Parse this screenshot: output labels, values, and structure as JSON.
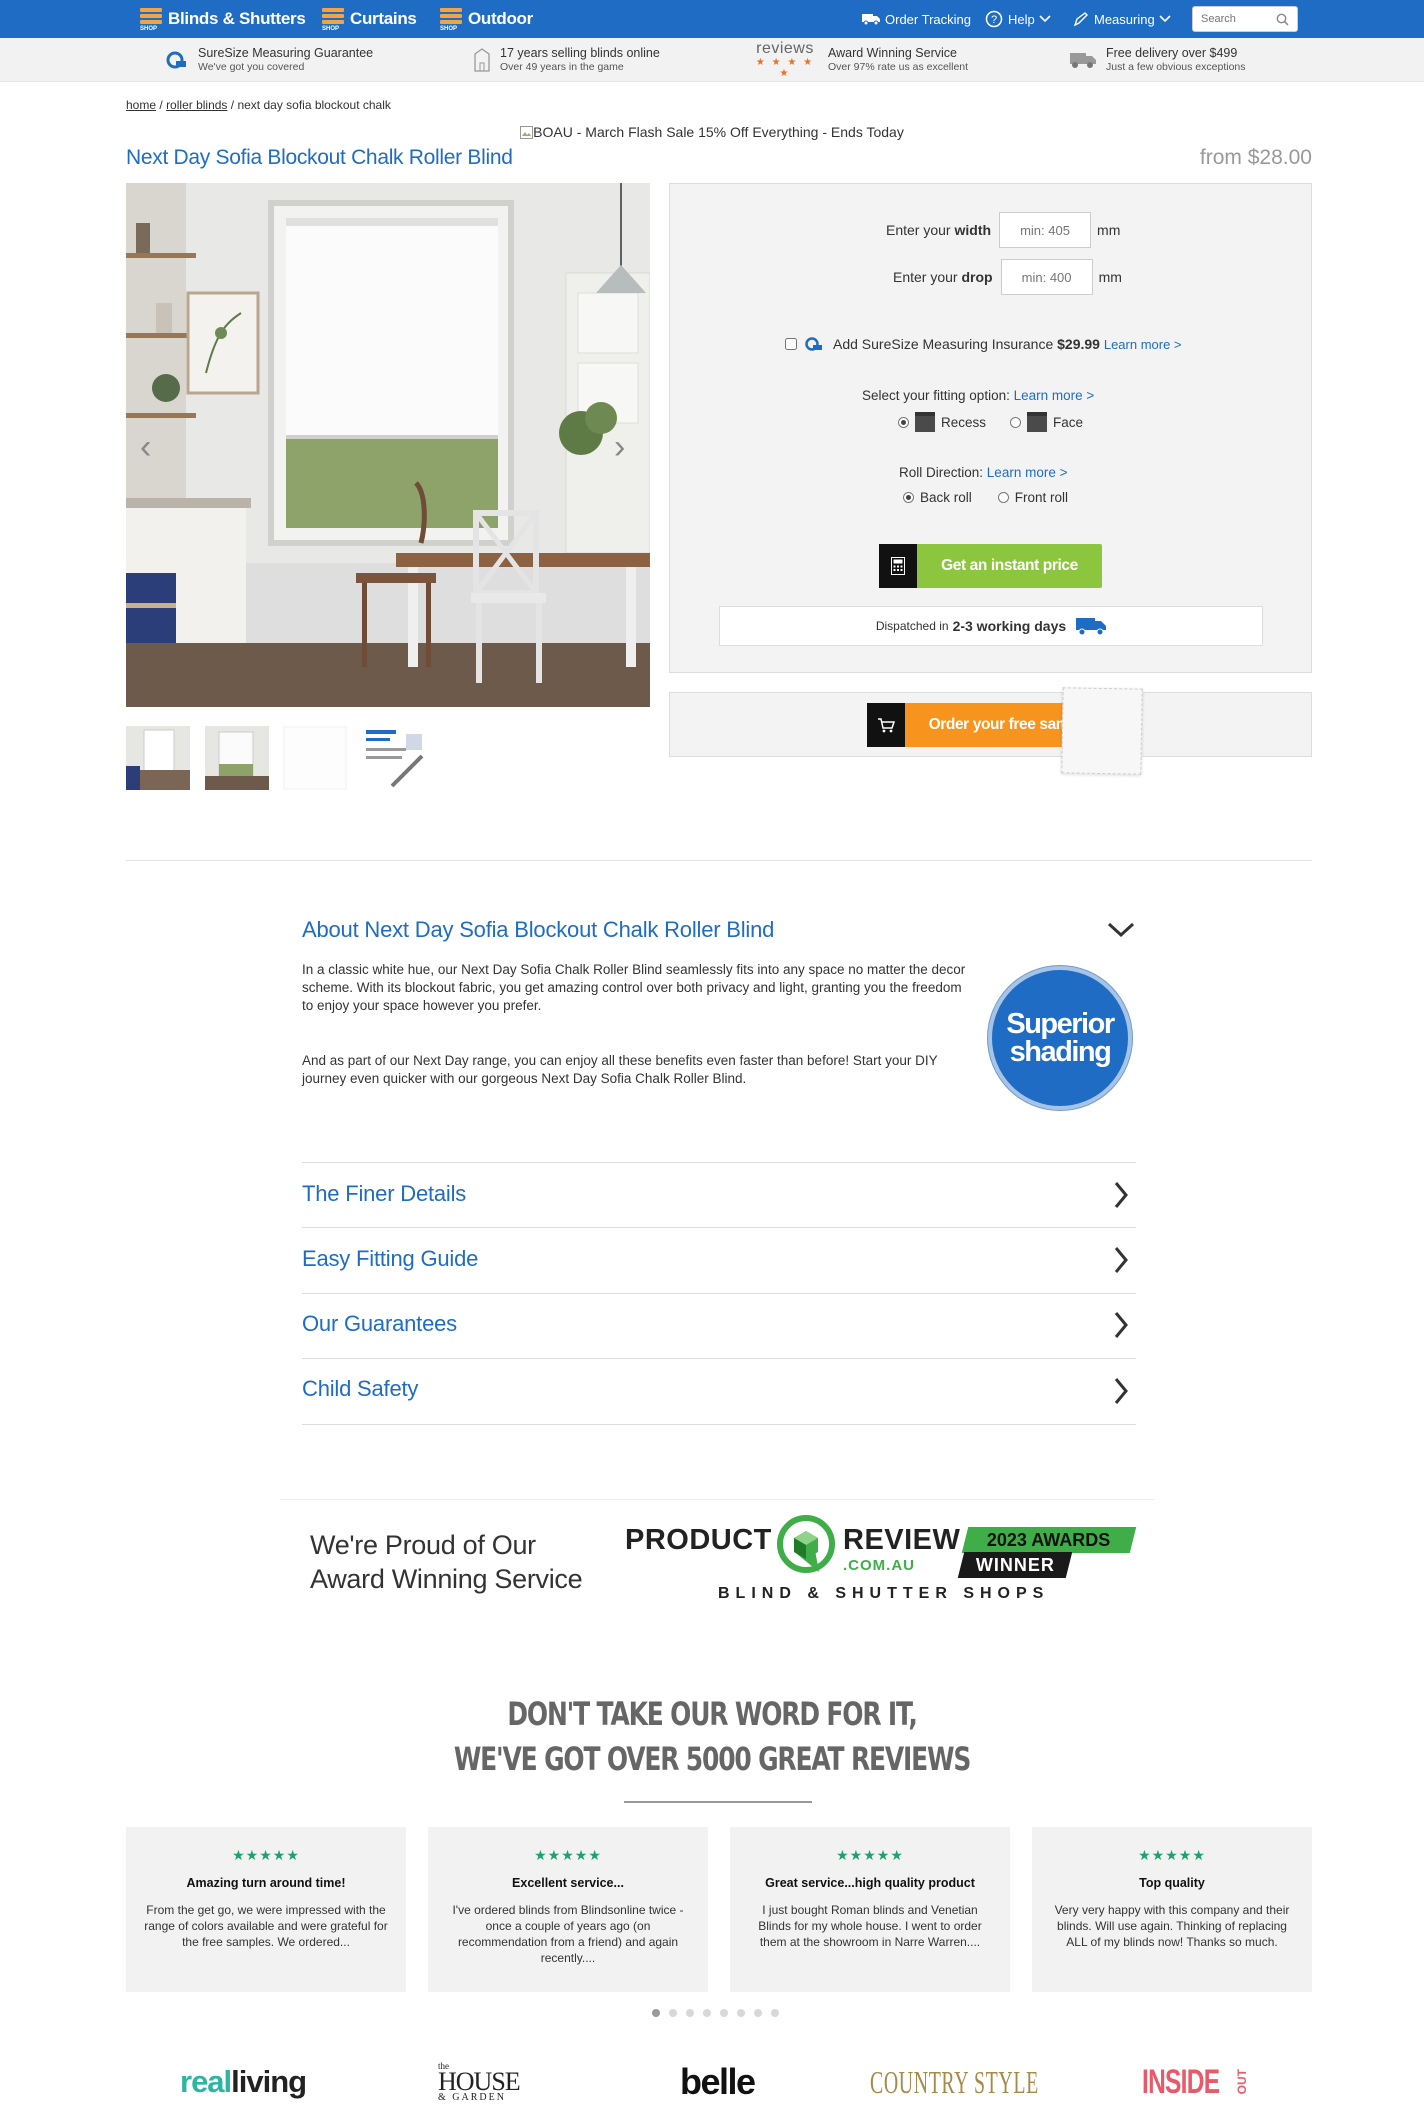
{
  "nav": {
    "items": [
      {
        "label": "Blinds & Shutters",
        "badge": "SHOP"
      },
      {
        "label": "Curtains",
        "badge": "SHOP"
      },
      {
        "label": "Outdoor",
        "badge": "SHOP"
      }
    ],
    "order_tracking": "Order Tracking",
    "help": "Help",
    "measuring": "Measuring",
    "search_placeholder": "Search"
  },
  "usp": [
    {
      "title": "SureSize Measuring Guarantee",
      "sub": "We've got you covered",
      "icon": "suresize-icon"
    },
    {
      "title": "17 years selling blinds online",
      "sub": "Over 49 years in the game",
      "icon": "building-icon"
    },
    {
      "title": "Award Winning Service",
      "sub": "Over 97% rate us as excellent",
      "icon": "reviews-logo",
      "logo_text": "reviews",
      "stars": "★ ★ ★ ★ ★"
    },
    {
      "title": "Free delivery over $499",
      "sub": "Just a few obvious exceptions",
      "icon": "truck-icon"
    }
  ],
  "breadcrumb": {
    "home": "home",
    "category": "roller blinds",
    "current": "next day sofia blockout chalk",
    "sep": "/"
  },
  "promo_banner": "BOAU - March Flash Sale 15% Off Everything - Ends Today",
  "product": {
    "title": "Next Day Sofia Blockout Chalk Roller Blind",
    "price": "from $28.00"
  },
  "configurator": {
    "width_label_pre": "Enter your",
    "width_label_bold": "width",
    "width_placeholder": "min: 405",
    "drop_label_pre": "Enter your",
    "drop_label_bold": "drop",
    "drop_placeholder": "min: 400",
    "unit": "mm",
    "insurance_label": "Add SureSize Measuring Insurance",
    "insurance_price": "$29.99",
    "learn_more": "Learn more >",
    "fitting_label": "Select your fitting option:",
    "fitting_options": [
      "Recess",
      "Face"
    ],
    "fitting_selected": "Recess",
    "roll_label": "Roll Direction:",
    "roll_options": [
      "Back roll",
      "Front roll"
    ],
    "roll_selected": "Back roll",
    "price_button": "Get an instant price",
    "dispatch_pre": "Dispatched in",
    "dispatch_days": "2-3 working days",
    "sample_button": "Order your free sample"
  },
  "about": {
    "title": "About Next Day Sofia Blockout Chalk Roller Blind",
    "p1": "In a classic white hue, our Next Day Sofia Chalk Roller Blind seamlessly fits into any space no matter the decor scheme. With its blockout fabric, you get amazing control over both privacy and light, granting you the freedom to enjoy your space however you prefer.",
    "p2": "And as part of our Next Day range, you can enjoy all these benefits even faster than before! Start your DIY journey even quicker with our gorgeous Next Day Sofia Chalk Roller Blind.",
    "badge_line1": "Superior",
    "badge_line2": "shading"
  },
  "accordion": [
    "The Finer Details",
    "Easy Fitting Guide",
    "Our Guarantees",
    "Child Safety"
  ],
  "award": {
    "line1": "We're Proud of Our",
    "line2": "Award Winning Service",
    "product": "PRODUCT",
    "review": "REVIEW",
    "comau": ".COM.AU",
    "year": "2023 AWARDS",
    "winner": "WINNER",
    "category": "BLIND & SHUTTER SHOPS"
  },
  "reviews": {
    "heading1": "DON'T TAKE OUR WORD FOR IT,",
    "heading2": "WE'VE GOT OVER 5000 GREAT REVIEWS",
    "cards": [
      {
        "stars": "★★★★★",
        "title": "Amazing turn around time!",
        "body": "From the get go, we were impressed with the range of colors available and were grateful for the free samples. We ordered..."
      },
      {
        "stars": "★★★★★",
        "title": "Excellent service...",
        "body": "I've ordered blinds from Blindsonline twice - once a couple of years ago (on recommendation from a friend) and again recently...."
      },
      {
        "stars": "★★★★★",
        "title": "Great service...high quality product",
        "body": "I just bought Roman blinds and Venetian Blinds for my whole house. I went to order them at the showroom in Narre Warren...."
      },
      {
        "stars": "★★★★★",
        "title": "Top quality",
        "body": "Very very happy with this company and their blinds. Will use again. Thinking of replacing ALL of my blinds now! Thanks so much."
      }
    ],
    "slide_count": 8,
    "active_slide": 1
  },
  "press": [
    {
      "part1": "real",
      "part2": "living"
    },
    {
      "part1": "the",
      "part2": "HOUSE",
      "part3": "&",
      "part4": "GARDEN"
    },
    {
      "part1": "belle"
    },
    {
      "part1": "COUNTRY STYLE"
    },
    {
      "part1": "INSIDE",
      "part2": "OUT"
    }
  ],
  "colors": {
    "brand_blue": "#1f6cc4",
    "accent_orange": "#f3a341",
    "price_green": "#8cc63f",
    "sample_orange": "#f7941d",
    "review_green": "#1aa36a"
  }
}
